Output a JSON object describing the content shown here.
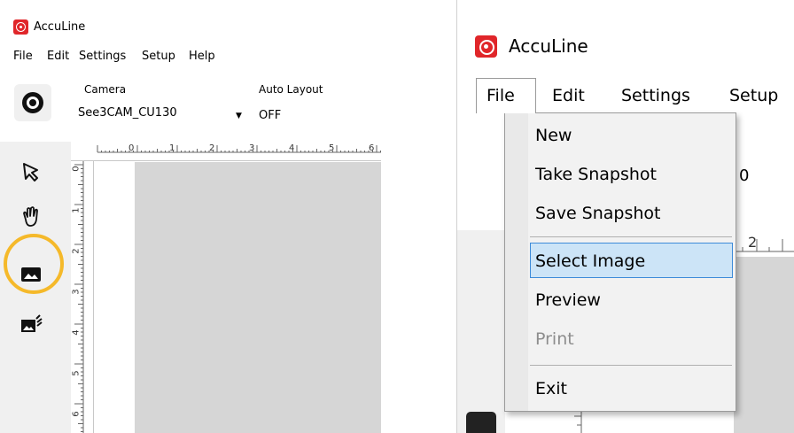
{
  "app": {
    "title": "AccuLine"
  },
  "menu": [
    "File",
    "Edit",
    "Settings",
    "Setup",
    "Help"
  ],
  "toolbar": {
    "camera_label": "Camera",
    "camera_value": "See3CAM_CU130",
    "layout_label": "Auto Layout",
    "layout_value": "OFF"
  },
  "ruler": {
    "top": [
      "0",
      "1",
      "2",
      "3",
      "4",
      "5",
      "6"
    ],
    "left": [
      "0",
      "1",
      "2",
      "3",
      "4",
      "5",
      "6"
    ]
  },
  "tools": [
    {
      "name": "pointer-icon"
    },
    {
      "name": "hand-icon"
    },
    {
      "name": "image-icon"
    },
    {
      "name": "image-flash-icon"
    }
  ],
  "zoom_view": {
    "title": "AccuLine",
    "menu": [
      "File",
      "Edit",
      "Settings",
      "Setup"
    ],
    "bg_ruler_digit": "2",
    "bg_peek": "0",
    "file_menu": {
      "items": [
        "New",
        "Take Snapshot",
        "Save Snapshot",
        "Select Image",
        "Preview",
        "Print",
        "Exit"
      ],
      "highlighted": "Select Image",
      "disabled": [
        "Print"
      ]
    }
  },
  "colors": {
    "accent_highlight": "#f5b92a",
    "brand_red": "#e0262a",
    "menu_highlight": "#cce4f7"
  }
}
